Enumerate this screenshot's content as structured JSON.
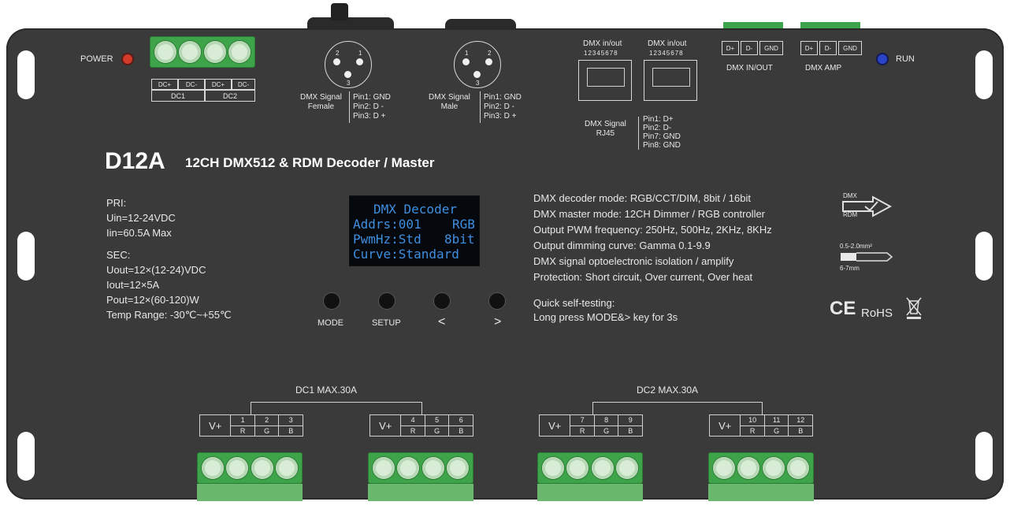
{
  "model": "D12A",
  "subtitle": "12CH DMX512 & RDM Decoder / Master",
  "indicators": {
    "power_label": "POWER",
    "run_label": "RUN",
    "power_color": "#d23a2a",
    "run_color": "#2a44c8"
  },
  "dc_labels": {
    "dc1_a": "DC+",
    "dc1_b": "DC-",
    "dc2_a": "DC+",
    "dc2_b": "DC-",
    "dc1": "DC1",
    "dc2": "DC2"
  },
  "xlr_female": {
    "label": "DMX Signal\nFemale",
    "pin_a": "2",
    "pin_b": "1",
    "pin_c": "3",
    "pins": [
      "Pin1: GND",
      "Pin2: D -",
      "Pin3: D +"
    ]
  },
  "xlr_male": {
    "label": "DMX Signal\nMale",
    "pin_a": "1",
    "pin_b": "2",
    "pin_c": "3",
    "pins": [
      "Pin1: GND",
      "Pin2: D -",
      "Pin3: D +"
    ]
  },
  "rj45": {
    "port1_label": "DMX in/out",
    "port2_label": "DMX in/out",
    "pin_numbers": "12345678",
    "label": "DMX Signal\nRJ45",
    "pins": [
      "Pin1: D+",
      "Pin2: D-",
      "Pin7: GND",
      "Pin8: GND"
    ]
  },
  "dmx_io": {
    "label": "DMX IN/OUT",
    "terms": [
      "D+",
      "D-",
      "GND"
    ]
  },
  "dmx_amp": {
    "label": "DMX  AMP",
    "terms": [
      "D+",
      "D-",
      "GND"
    ]
  },
  "pri": [
    "PRI:",
    "Uin=12-24VDC",
    "Iin=60.5A Max"
  ],
  "sec": [
    "SEC:",
    "Uout=12×(12-24)VDC",
    "Iout=12×5A",
    "Pout=12×(60-120)W",
    "Temp Range: -30℃~+55℃"
  ],
  "display": {
    "line1": "DMX Decoder",
    "line2a": "Addrs:001",
    "line2b": "RGB",
    "line3a": "PwmHz:Std",
    "line3b": "8bit",
    "line4": "Curve:Standard",
    "text_color": "#3f8fe0"
  },
  "buttons": {
    "mode": "MODE",
    "setup": "SETUP",
    "prev": "<",
    "next": ">"
  },
  "features": [
    "DMX decoder mode: RGB/CCT/DIM, 8bit / 16bit",
    "DMX master mode: 12CH Dimmer / RGB controller",
    "Output PWM frequency: 250Hz, 500Hz, 2KHz, 8KHz",
    "Output dimming curve: Gamma 0.1-9.9",
    "DMX signal optoelectronic isolation / amplify",
    "Protection: Short circuit, Over current, Over heat"
  ],
  "self_test": [
    "Quick self-testing:",
    "Long press MODE&> key for 3s"
  ],
  "icons": {
    "dmx_label": "DMX",
    "rdm_label": "RDM",
    "wire_top": "0.5-2.0mm²",
    "wire_bottom": "6-7mm",
    "ce": "CE",
    "rohs": "RoHS"
  },
  "outputs": {
    "dc1_label": "DC1  MAX.30A",
    "dc2_label": "DC2  MAX.30A",
    "groups": [
      {
        "vplus": "V+",
        "ch": [
          "1",
          "2",
          "3"
        ],
        "col": [
          "R",
          "G",
          "B"
        ]
      },
      {
        "vplus": "V+",
        "ch": [
          "4",
          "5",
          "6"
        ],
        "col": [
          "R",
          "G",
          "B"
        ]
      },
      {
        "vplus": "V+",
        "ch": [
          "7",
          "8",
          "9"
        ],
        "col": [
          "R",
          "G",
          "B"
        ]
      },
      {
        "vplus": "V+",
        "ch": [
          "10",
          "11",
          "12"
        ],
        "col": [
          "R",
          "G",
          "B"
        ]
      }
    ]
  }
}
